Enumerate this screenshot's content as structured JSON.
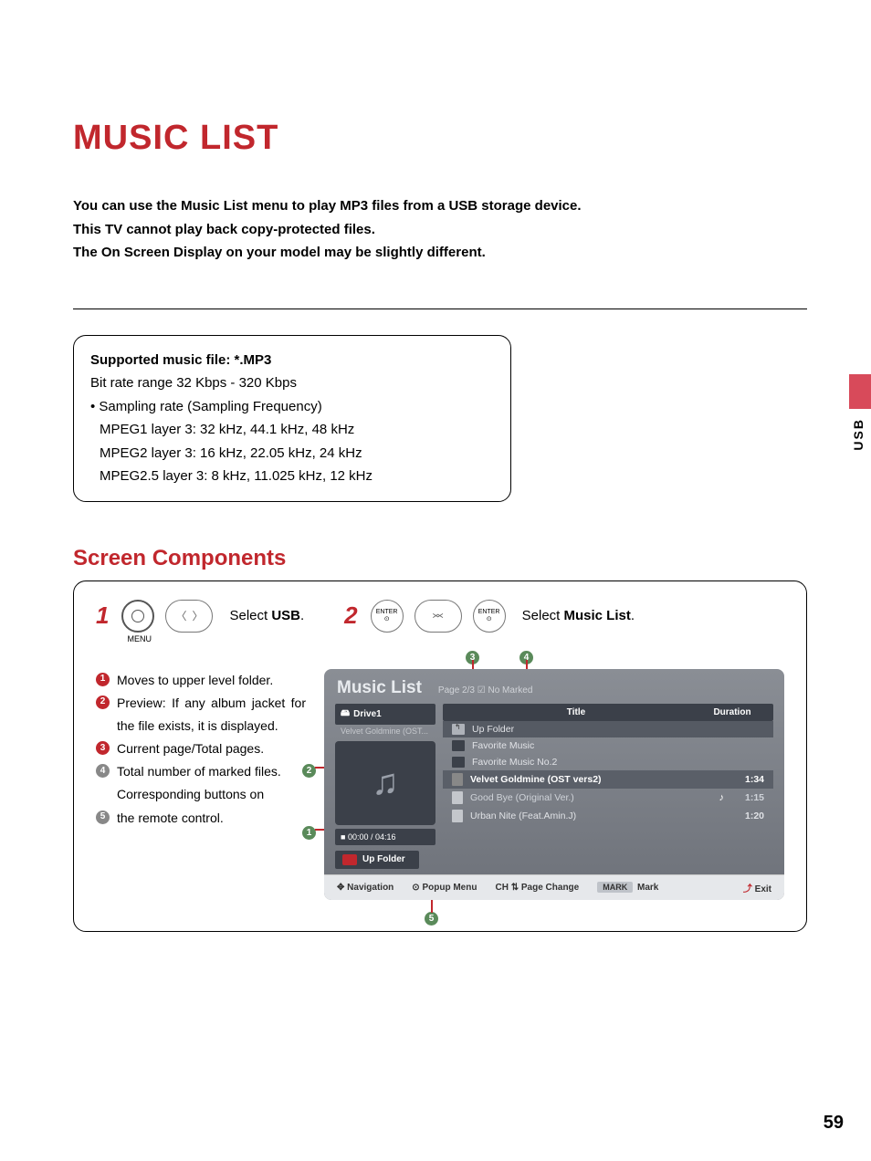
{
  "title": "MUSIC LIST",
  "intro": {
    "l1": "You can use the Music List menu to play MP3 files from a USB storage device.",
    "l2": "This TV cannot play back copy-protected files.",
    "l3": "The On Screen Display on your model may be slightly different."
  },
  "spec": {
    "head": "Supported music file: *.MP3",
    "l1": "Bit rate range 32 Kbps - 320 Kbps",
    "l2": "• Sampling rate (Sampling Frequency)",
    "l3": "MPEG1 layer 3: 32 kHz, 44.1 kHz, 48 kHz",
    "l4": "MPEG2 layer 3: 16 kHz, 22.05  kHz, 24 kHz",
    "l5": "MPEG2.5 layer 3: 8 kHz, 11.025 kHz, 12 kHz"
  },
  "side_tab": "USB",
  "subheading": "Screen Components",
  "steps": {
    "s1_num": "1",
    "s1_menu": "MENU",
    "s1_text_a": "Select ",
    "s1_text_b": "USB",
    "s1_text_c": ".",
    "s2_num": "2",
    "s2_enter": "ENTER",
    "s2_text_a": "Select ",
    "s2_text_b": "Music List",
    "s2_text_c": "."
  },
  "legend": {
    "i1": "Moves to upper level folder.",
    "i2": "Preview: If any album jacket for the file exists, it is displayed.",
    "i3": "Current page/Total pages.",
    "i4": "Total number of marked files.",
    "i4b": "Corresponding buttons on",
    "i5": "the remote control."
  },
  "tv": {
    "title": "Music List",
    "page": "Page 2/3",
    "marked": "No Marked",
    "drive": "Drive1",
    "subfolder": "Velvet Goldmine (OST...",
    "time": "00:00 / 04:16",
    "upfolder_btn": "Up Folder",
    "cols": {
      "title": "Title",
      "duration": "Duration"
    },
    "rows": [
      {
        "type": "up",
        "title": "Up Folder",
        "dur": ""
      },
      {
        "type": "folder",
        "title": "Favorite Music",
        "dur": ""
      },
      {
        "type": "folder",
        "title": "Favorite Music No.2",
        "dur": ""
      },
      {
        "type": "file",
        "title": "Velvet Goldmine (OST vers2)",
        "dur": "1:34",
        "hl": true
      },
      {
        "type": "file",
        "title": "Good Bye (Original Ver.)",
        "dur": "1:15",
        "playing": true
      },
      {
        "type": "file",
        "title": "Urban Nite (Feat.Amin.J)",
        "dur": "1:20"
      }
    ],
    "footer": {
      "nav": "Navigation",
      "popup": "Popup Menu",
      "ch": "CH",
      "page_change": "Page Change",
      "mark_pill": "MARK",
      "mark": "Mark",
      "exit": "Exit"
    }
  },
  "callouts": {
    "c1": "1",
    "c2": "2",
    "c3": "3",
    "c4": "4",
    "c5": "5"
  },
  "pagenum": "59"
}
